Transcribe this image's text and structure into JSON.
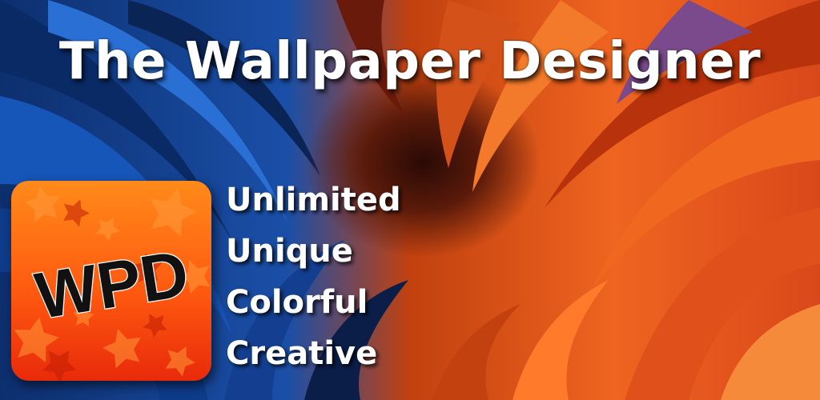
{
  "banner": {
    "title": "The Wallpaper Designer",
    "app_icon": {
      "text": "WPD",
      "icon": "star-pattern-icon"
    },
    "taglines": [
      "Unlimited",
      "Unique",
      "Colorful",
      "Creative"
    ]
  },
  "colors": {
    "blue_dark": "#0b1a3a",
    "blue": "#1d5fc2",
    "orange": "#f2601a",
    "red_orange": "#e23a10",
    "purple": "#7a4a8c",
    "text": "#ffffff"
  }
}
